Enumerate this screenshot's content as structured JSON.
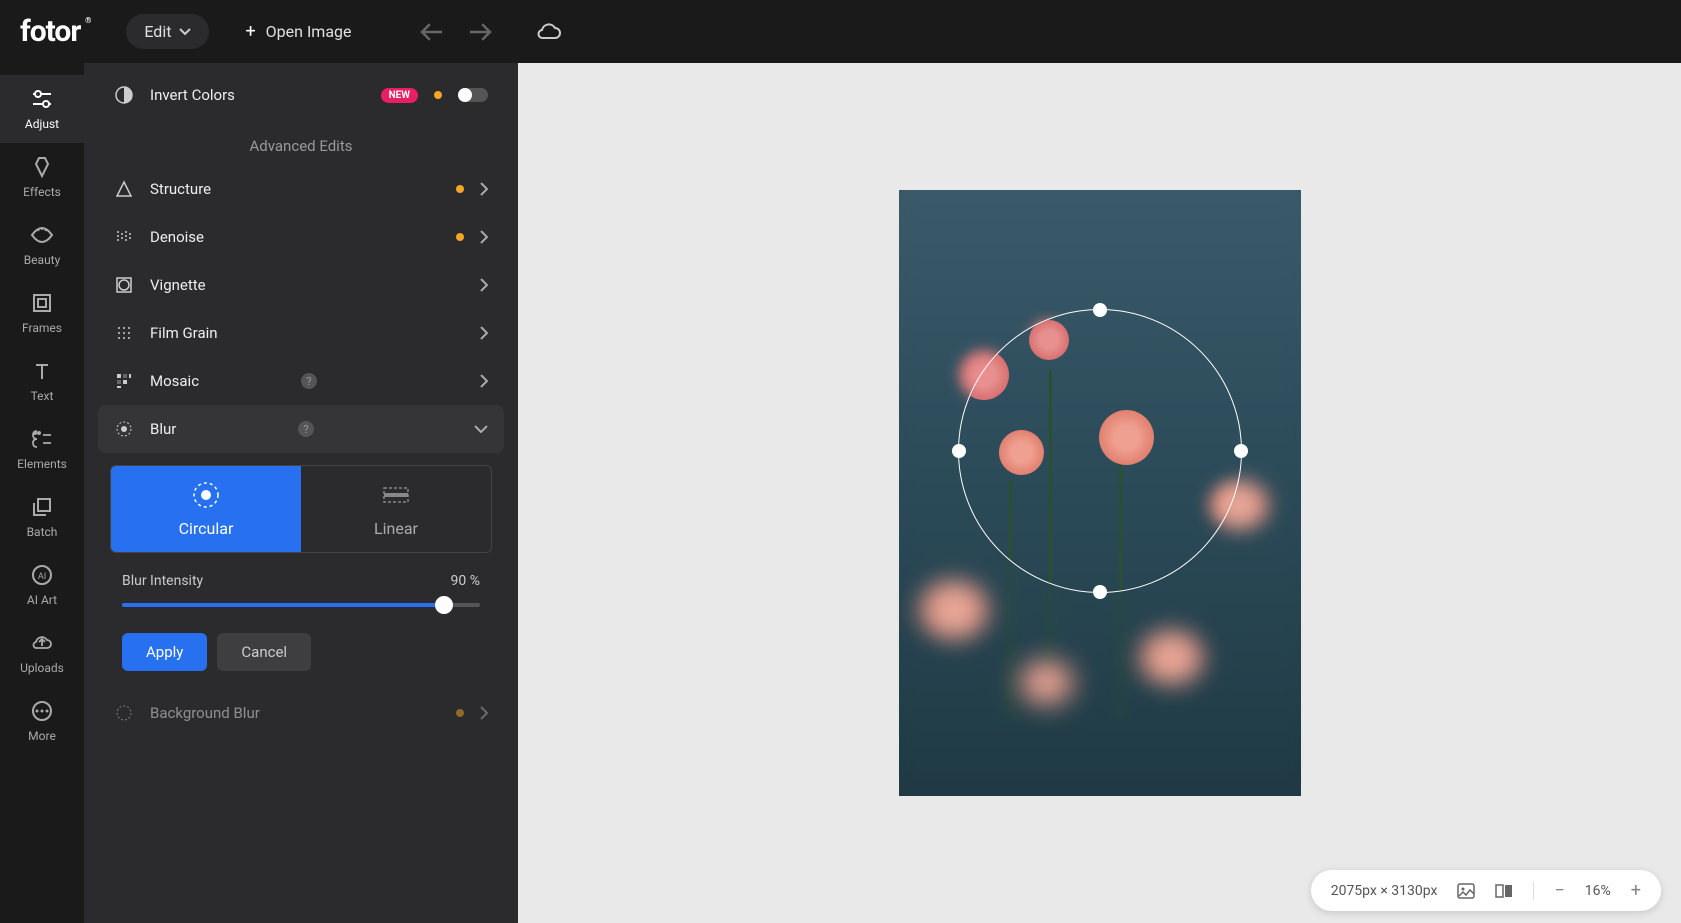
{
  "topbar": {
    "logo": "fotor",
    "edit_label": "Edit",
    "open_image_label": "Open Image"
  },
  "rail": {
    "items": [
      {
        "label": "Adjust"
      },
      {
        "label": "Effects"
      },
      {
        "label": "Beauty"
      },
      {
        "label": "Frames"
      },
      {
        "label": "Text"
      },
      {
        "label": "Elements"
      },
      {
        "label": "Batch"
      },
      {
        "label": "AI Art"
      },
      {
        "label": "Uploads"
      },
      {
        "label": "More"
      }
    ]
  },
  "panel": {
    "invert_colors_label": "Invert Colors",
    "new_badge": "NEW",
    "section_title": "Advanced Edits",
    "rows": {
      "structure": "Structure",
      "denoise": "Denoise",
      "vignette": "Vignette",
      "film_grain": "Film Grain",
      "mosaic": "Mosaic",
      "blur": "Blur",
      "background_blur": "Background Blur"
    },
    "blur": {
      "tabs": {
        "circular": "Circular",
        "linear": "Linear"
      },
      "intensity_label": "Blur Intensity",
      "intensity_value": "90 %",
      "intensity_pct": 90,
      "apply": "Apply",
      "cancel": "Cancel"
    }
  },
  "status": {
    "dimensions": "2075px × 3130px",
    "zoom": "16%"
  }
}
